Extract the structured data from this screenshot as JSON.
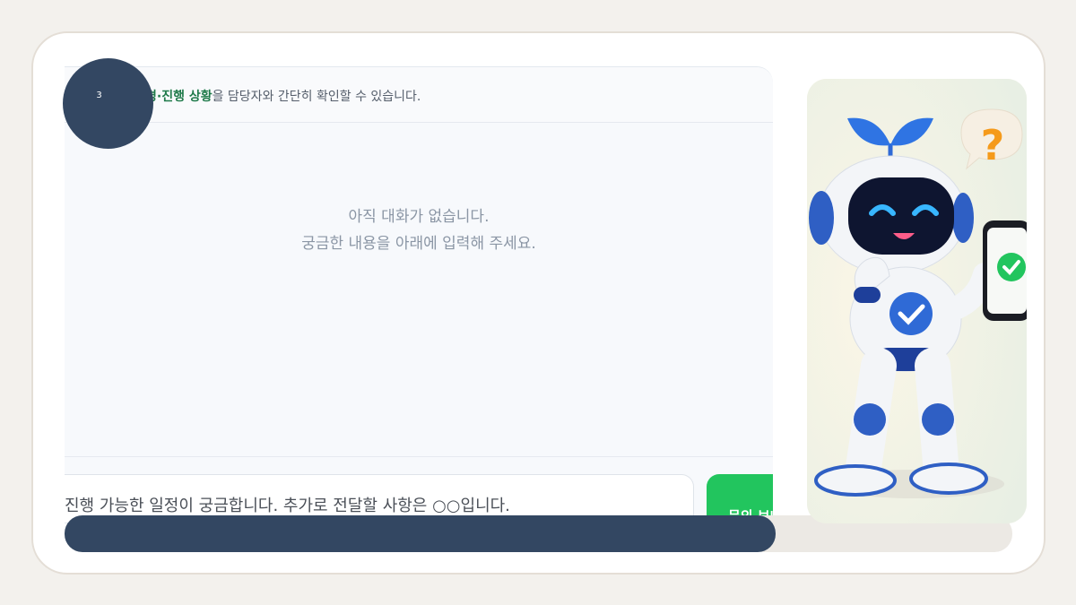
{
  "step": {
    "number": "3"
  },
  "chat": {
    "header": {
      "prefix_visible": "",
      "highlight": "경·진행 상황",
      "suffix": "을 담당자와 간단히 확인할 수 있습니다."
    },
    "empty_state": {
      "line1": "아직 대화가 없습니다.",
      "line2": "궁금한 내용을 아래에 입력해 주세요."
    },
    "composer": {
      "value": "진행 가능한 일정이 궁금합니다. 추가로 전달할 사항은 ○○입니다.",
      "send_label": "문의 보내기"
    }
  },
  "progress": {
    "fraction": 0.75
  },
  "colors": {
    "accent_green": "#22c55e",
    "highlight_green": "#1f7a4a",
    "navy": "#334762"
  },
  "illustration": {
    "subject": "robot-mascot-with-phone-icon"
  }
}
